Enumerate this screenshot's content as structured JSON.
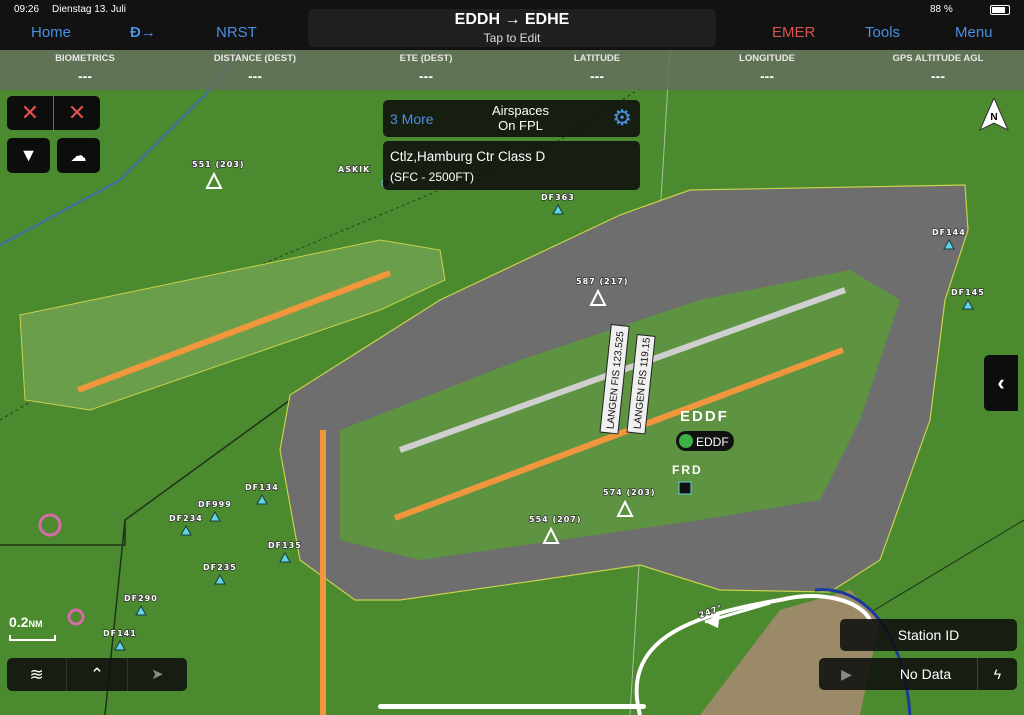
{
  "status": {
    "time": "09:26",
    "date": "Dienstag 13. Juli",
    "battery": "88 %"
  },
  "nav": {
    "home": "Home",
    "direct_to_icon": "direct-to-icon",
    "nrst": "NRST",
    "emer": "EMER",
    "tools": "Tools",
    "menu": "Menu"
  },
  "flight_plan": {
    "route": "EDDH → EDHE",
    "hint": "Tap to Edit"
  },
  "instruments": [
    {
      "label": "BIOMETRICS",
      "value": "---"
    },
    {
      "label": "DISTANCE (DEST)",
      "value": "---"
    },
    {
      "label": "ETE (DEST)",
      "value": "---"
    },
    {
      "label": "LATITUDE",
      "value": "---"
    },
    {
      "label": "LONGITUDE",
      "value": "---"
    },
    {
      "label": "GPS ALTITUDE AGL",
      "value": "---"
    }
  ],
  "airspace": {
    "more": "3 More",
    "title_line1": "Airspaces",
    "title_line2": "On FPL",
    "name": "Ctlz,Hamburg Ctr Class D",
    "altitudes": "(SFC - 2500FT)"
  },
  "compass": "N",
  "scale": {
    "value": "0.2",
    "unit": "NM"
  },
  "map": {
    "airport_id": "EDDF",
    "airport_chip": "EDDF",
    "vor": "FRD",
    "heading": "247°",
    "fix": "ASKIK",
    "freq_labels": [
      "LANGEN FIS 123.525",
      "LANGEN FIS 119.15"
    ],
    "obstacles": [
      "551 (203)",
      "587 (217)",
      "574 (203)",
      "554 (207)"
    ],
    "waypoints": [
      "DF363",
      "DF144",
      "DF145",
      "DF134",
      "DF999",
      "DF234",
      "DF135",
      "DF235",
      "DF290",
      "DF141"
    ],
    "colors": {
      "terrain": "#4b8a2f",
      "runway": "#f0963c",
      "airspace_class_d": "#c8d24a",
      "route": "#1b3a9c",
      "track": "#ffffff"
    }
  },
  "station": {
    "title": "Station ID",
    "status": "No Data"
  }
}
